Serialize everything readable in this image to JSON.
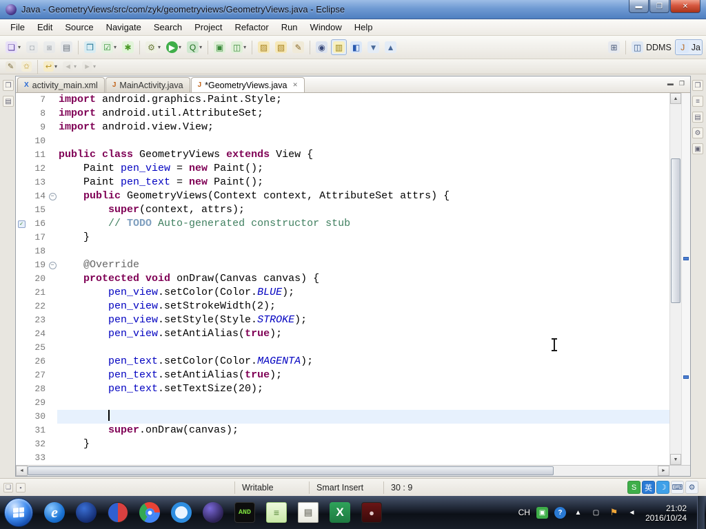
{
  "window": {
    "title": "Java - GeometryViews/src/com/zyk/geometryviews/GeometryViews.java - Eclipse",
    "controls": [
      {
        "name": "minimize-button",
        "glyph": "▬",
        "cls": "min"
      },
      {
        "name": "maximize-button",
        "glyph": "❐",
        "cls": "max"
      },
      {
        "name": "close-button",
        "glyph": "✕",
        "cls": "close"
      }
    ]
  },
  "icons": {
    "up": "▲",
    "down": "▼",
    "left": "◄",
    "right": "►",
    "close": "✕",
    "min": "▬",
    "max": "❐",
    "caret": "▾",
    "check": "✓",
    "fold": "−"
  },
  "menu": {
    "items": [
      "File",
      "Edit",
      "Source",
      "Navigate",
      "Search",
      "Project",
      "Refactor",
      "Run",
      "Window",
      "Help"
    ]
  },
  "toolbar": {
    "row1": [
      {
        "name": "new-wizard-icon",
        "glyph": "❏",
        "bg": "#e9e1f8",
        "fg": "#5a3fa0",
        "drop": true
      },
      {
        "name": "save-icon",
        "glyph": "◘",
        "bg": "#dfe4ea",
        "fg": "#7a8694",
        "disabled": true
      },
      {
        "name": "save-all-icon",
        "glyph": "◙",
        "bg": "#dfe4ea",
        "fg": "#7a8694",
        "disabled": true
      },
      {
        "name": "print-icon",
        "glyph": "▤",
        "bg": "#e7e9eb",
        "fg": "#67707a"
      },
      {
        "sep": true
      },
      {
        "name": "new-java-item-icon",
        "glyph": "❒",
        "bg": "#d8ecf2",
        "fg": "#2a7a9a"
      },
      {
        "name": "checkbox-dropdown-icon",
        "glyph": "☑",
        "bg": "#e4f2e0",
        "fg": "#2f8f2f",
        "drop": true
      },
      {
        "name": "new-android-project-icon",
        "glyph": "✱",
        "bg": "#e2f4da",
        "fg": "#4a9a28"
      },
      {
        "sep": true
      },
      {
        "name": "debug-icon",
        "glyph": "⚙",
        "bg": "#eef0e4",
        "fg": "#6a7a3a",
        "drop": true
      },
      {
        "name": "run-icon",
        "glyph": "▶",
        "bg": "#3fae49",
        "fg": "#ffffff",
        "drop": true
      },
      {
        "name": "coverage-icon",
        "glyph": "Q",
        "bg": "#cfe8cf",
        "fg": "#1a6a1a",
        "drop": true
      },
      {
        "sep": true
      },
      {
        "name": "android-sdk-manager-icon",
        "glyph": "▣",
        "bg": "#dff0d8",
        "fg": "#3a8a3a"
      },
      {
        "name": "android-virtual-device-icon",
        "glyph": "◫",
        "bg": "#dff0d8",
        "fg": "#3a8a3a",
        "drop": true
      },
      {
        "sep": true
      },
      {
        "name": "open-folder-icon",
        "glyph": "▨",
        "bg": "#f6e8b8",
        "fg": "#a8821e"
      },
      {
        "name": "import-folder-icon",
        "glyph": "▧",
        "bg": "#f6e8b8",
        "fg": "#a8821e"
      },
      {
        "name": "edit-pencil-icon",
        "glyph": "✎",
        "bg": "#f0ead8",
        "fg": "#8a6a2a"
      },
      {
        "sep": true
      },
      {
        "name": "search-icon",
        "glyph": "◉",
        "bg": "#dde4f0",
        "fg": "#3a4a7a"
      },
      {
        "name": "mark-occurrences-icon",
        "glyph": "▥",
        "bg": "#f8f0c0",
        "fg": "#9a8418",
        "pressed": true
      },
      {
        "name": "last-edit-location-icon",
        "glyph": "◧",
        "bg": "#dce8f8",
        "fg": "#2a5ab0"
      },
      {
        "name": "next-annotation-icon",
        "glyph": "▼",
        "bg": "#e4ecf6",
        "fg": "#4a6a9a"
      },
      {
        "name": "prev-annotation-icon",
        "glyph": "▲",
        "bg": "#e4ecf6",
        "fg": "#4a6a9a"
      }
    ],
    "row2": [
      {
        "name": "annotation-pencil-icon",
        "glyph": "✎",
        "bg": "#ece8dc",
        "fg": "#7a6a3a"
      },
      {
        "name": "favorites-star-icon",
        "glyph": "✩",
        "bg": "#f4eed8",
        "fg": "#c0982a"
      },
      {
        "sep": true
      },
      {
        "name": "last-edit-arrow-icon",
        "glyph": "↩",
        "bg": "#f6ecc8",
        "fg": "#b8921e",
        "drop": true
      },
      {
        "name": "back-icon",
        "glyph": "◄",
        "bg": "#e8e6e0",
        "fg": "#8a8880",
        "drop": true,
        "disabled": true
      },
      {
        "name": "forward-icon",
        "glyph": "►",
        "bg": "#e8e6e0",
        "fg": "#8a8880",
        "drop": true,
        "disabled": true
      }
    ],
    "perspectives": [
      {
        "name": "open-perspective-icon",
        "glyph": "⊞",
        "bg": "#e6e9ef",
        "fg": "#4a5a7a"
      },
      {
        "sep": true
      },
      {
        "name": "ddms-perspective-icon",
        "glyph": "◫",
        "bg": "#dfe8f4",
        "fg": "#3a5a8a",
        "label": "DDMS"
      },
      {
        "name": "java-perspective-icon",
        "glyph": "J",
        "bg": "#dbe8fa",
        "fg": "#b5651d",
        "label": "Ja",
        "pressed": true
      }
    ]
  },
  "tabs": [
    {
      "label": "activity_main.xml",
      "icon": "xml-file-icon",
      "glyph": "X",
      "cls": "xml",
      "active": false
    },
    {
      "label": "MainActivity.java",
      "icon": "java-file-icon",
      "glyph": "J",
      "cls": "java",
      "active": false
    },
    {
      "label": "*GeometryViews.java",
      "icon": "java-file-icon",
      "glyph": "J",
      "cls": "java",
      "active": true,
      "closable": true
    }
  ],
  "strips": {
    "left": [
      {
        "name": "restore-panel-icon",
        "glyph": "❐"
      },
      {
        "name": "package-explorer-icon",
        "glyph": "▤"
      }
    ],
    "right": [
      {
        "name": "restore-panel-icon",
        "glyph": "❐"
      },
      {
        "name": "outline-icon",
        "glyph": "≡"
      },
      {
        "name": "task-list-icon",
        "glyph": "▤"
      },
      {
        "name": "build-icon",
        "glyph": "⚙"
      },
      {
        "name": "snippets-icon",
        "glyph": "▣"
      }
    ]
  },
  "editor": {
    "lines": [
      {
        "n": 7,
        "seg": [
          [
            "kw",
            "import"
          ],
          [
            "pl",
            " android.graphics.Paint.Style;"
          ]
        ]
      },
      {
        "n": 8,
        "seg": [
          [
            "kw",
            "import"
          ],
          [
            "pl",
            " android.util.AttributeSet;"
          ]
        ]
      },
      {
        "n": 9,
        "seg": [
          [
            "kw",
            "import"
          ],
          [
            "pl",
            " android.view.View;"
          ]
        ]
      },
      {
        "n": 10,
        "seg": []
      },
      {
        "n": 11,
        "seg": [
          [
            "kw",
            "public"
          ],
          [
            "pl",
            " "
          ],
          [
            "kw",
            "class"
          ],
          [
            "pl",
            " GeometryViews "
          ],
          [
            "kw",
            "extends"
          ],
          [
            "pl",
            " View {"
          ]
        ]
      },
      {
        "n": 12,
        "seg": [
          [
            "pl",
            "    Paint "
          ],
          [
            "fld",
            "pen_view"
          ],
          [
            "pl",
            " = "
          ],
          [
            "kw",
            "new"
          ],
          [
            "pl",
            " Paint();"
          ]
        ]
      },
      {
        "n": 13,
        "seg": [
          [
            "pl",
            "    Paint "
          ],
          [
            "fld",
            "pen_text"
          ],
          [
            "pl",
            " = "
          ],
          [
            "kw",
            "new"
          ],
          [
            "pl",
            " Paint();"
          ]
        ]
      },
      {
        "n": 14,
        "fold": true,
        "seg": [
          [
            "pl",
            "    "
          ],
          [
            "kw",
            "public"
          ],
          [
            "pl",
            " GeometryViews(Context context, AttributeSet attrs) {"
          ]
        ]
      },
      {
        "n": 15,
        "seg": [
          [
            "pl",
            "        "
          ],
          [
            "kw",
            "super"
          ],
          [
            "pl",
            "(context, attrs);"
          ]
        ]
      },
      {
        "n": 16,
        "task": true,
        "seg": [
          [
            "com",
            "        // "
          ],
          [
            "todo",
            "TODO"
          ],
          [
            "com",
            " Auto-generated constructor stub"
          ]
        ]
      },
      {
        "n": 17,
        "seg": [
          [
            "pl",
            "    }"
          ]
        ]
      },
      {
        "n": 18,
        "seg": []
      },
      {
        "n": 19,
        "fold": true,
        "seg": [
          [
            "ann",
            "    @Override"
          ]
        ]
      },
      {
        "n": 20,
        "seg": [
          [
            "pl",
            "    "
          ],
          [
            "kw",
            "protected"
          ],
          [
            "pl",
            " "
          ],
          [
            "kw",
            "void"
          ],
          [
            "pl",
            " onDraw(Canvas canvas) {"
          ]
        ]
      },
      {
        "n": 21,
        "seg": [
          [
            "pl",
            "        "
          ],
          [
            "fld",
            "pen_view"
          ],
          [
            "pl",
            ".setColor(Color."
          ],
          [
            "sf",
            "BLUE"
          ],
          [
            "pl",
            ");"
          ]
        ]
      },
      {
        "n": 22,
        "seg": [
          [
            "pl",
            "        "
          ],
          [
            "fld",
            "pen_view"
          ],
          [
            "pl",
            ".setStrokeWidth(2);"
          ]
        ]
      },
      {
        "n": 23,
        "seg": [
          [
            "pl",
            "        "
          ],
          [
            "fld",
            "pen_view"
          ],
          [
            "pl",
            ".setStyle(Style."
          ],
          [
            "sf",
            "STROKE"
          ],
          [
            "pl",
            ");"
          ]
        ]
      },
      {
        "n": 24,
        "seg": [
          [
            "pl",
            "        "
          ],
          [
            "fld",
            "pen_view"
          ],
          [
            "pl",
            ".setAntiAlias("
          ],
          [
            "kw",
            "true"
          ],
          [
            "pl",
            ");"
          ]
        ]
      },
      {
        "n": 25,
        "seg": []
      },
      {
        "n": 26,
        "seg": [
          [
            "pl",
            "        "
          ],
          [
            "fld",
            "pen_text"
          ],
          [
            "pl",
            ".setColor(Color."
          ],
          [
            "sf",
            "MAGENTA"
          ],
          [
            "pl",
            ");"
          ]
        ]
      },
      {
        "n": 27,
        "seg": [
          [
            "pl",
            "        "
          ],
          [
            "fld",
            "pen_text"
          ],
          [
            "pl",
            ".setAntiAlias("
          ],
          [
            "kw",
            "true"
          ],
          [
            "pl",
            ");"
          ]
        ]
      },
      {
        "n": 28,
        "seg": [
          [
            "pl",
            "        "
          ],
          [
            "fld",
            "pen_text"
          ],
          [
            "pl",
            ".setTextSize(20);"
          ]
        ]
      },
      {
        "n": 29,
        "seg": []
      },
      {
        "n": 30,
        "current": true,
        "caret": true,
        "seg": [
          [
            "pl",
            "        "
          ]
        ]
      },
      {
        "n": 31,
        "seg": [
          [
            "pl",
            "        "
          ],
          [
            "kw",
            "super"
          ],
          [
            "pl",
            ".onDraw(canvas);"
          ]
        ]
      },
      {
        "n": 32,
        "seg": [
          [
            "pl",
            "    }"
          ]
        ]
      },
      {
        "n": 33,
        "seg": []
      }
    ],
    "overview_marks": [
      44,
      76
    ]
  },
  "status": {
    "writable": "Writable",
    "insert": "Smart Insert",
    "position": "30 : 9",
    "left_icons": [
      {
        "name": "fast-view-icon",
        "glyph": "❏"
      },
      {
        "name": "trim-stack-icon",
        "glyph": "▪"
      }
    ]
  },
  "ime": [
    {
      "name": "sogou-icon",
      "glyph": "S",
      "bg": "#3fae49",
      "fg": "#ffffff"
    },
    {
      "name": "ime-lang-icon",
      "glyph": "英",
      "bg": "#2a7ad4",
      "fg": "#ffffff"
    },
    {
      "name": "ime-moon-icon",
      "glyph": "☽",
      "bg": "#3fa0e8",
      "fg": "#ffffff"
    },
    {
      "name": "ime-keyboard-icon",
      "glyph": "⌨",
      "bg": "#eef2f8",
      "fg": "#3a5a8a"
    },
    {
      "name": "ime-wrench-icon",
      "glyph": "⚙",
      "bg": "#eef2f8",
      "fg": "#3a5a8a"
    }
  ],
  "taskbar": {
    "apps": [
      {
        "name": "ie-icon",
        "glyph": "e",
        "cls": "ie"
      },
      {
        "name": "browser-dark-icon",
        "glyph": "",
        "cls": "nav"
      },
      {
        "name": "orb-app-icon",
        "glyph": "",
        "cls": "orb"
      },
      {
        "name": "chrome-icon",
        "glyph": "",
        "cls": "chrome"
      },
      {
        "name": "ring-app-icon",
        "glyph": "",
        "cls": "ring"
      },
      {
        "name": "eclipse-taskbar-icon",
        "glyph": "",
        "cls": "eclipse"
      },
      {
        "name": "android-tool-icon",
        "glyph": "AND",
        "cls": "android"
      },
      {
        "name": "notes-app-icon",
        "glyph": "≡",
        "cls": "notes"
      },
      {
        "name": "notepad-icon",
        "glyph": "▤",
        "cls": "notepad"
      },
      {
        "name": "excel-icon",
        "glyph": "X",
        "cls": "excel"
      },
      {
        "name": "recorder-icon",
        "glyph": "●",
        "cls": "recorder"
      }
    ]
  },
  "tray": {
    "items": [
      {
        "name": "ime-ch-indicator",
        "glyph": "CH",
        "cls": "text"
      },
      {
        "name": "tray-green-icon",
        "glyph": "▣",
        "cls": "green"
      },
      {
        "name": "tray-help-icon",
        "glyph": "?",
        "cls": "help"
      },
      {
        "name": "hidden-icons-icon",
        "glyph": "▲",
        "cls": "plain"
      },
      {
        "name": "network-icon",
        "glyph": "▢",
        "cls": "plain"
      },
      {
        "name": "action-center-icon",
        "glyph": "⚑",
        "cls": "alert"
      },
      {
        "name": "volume-icon",
        "glyph": "◄",
        "cls": "plain"
      }
    ],
    "time": "21:02",
    "date": "2016/10/24"
  }
}
